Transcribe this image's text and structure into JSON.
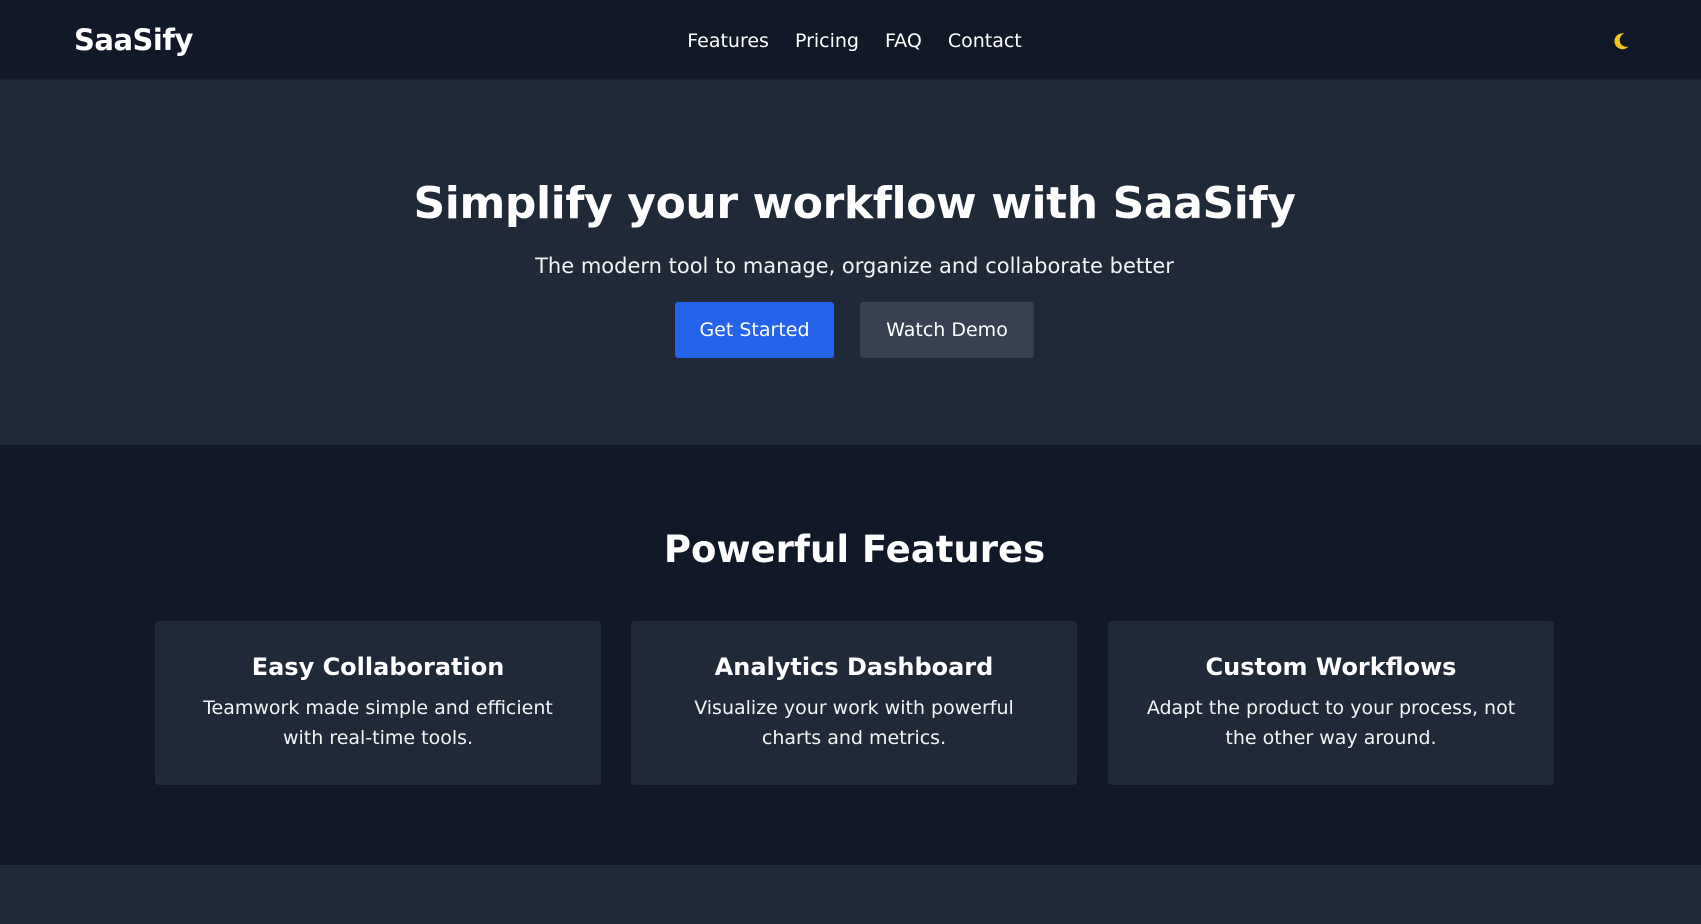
{
  "nav": {
    "logo": "SaaSify",
    "links": [
      "Features",
      "Pricing",
      "FAQ",
      "Contact"
    ],
    "theme_icon": "moon-icon"
  },
  "hero": {
    "title": "Simplify your workflow with SaaSify",
    "subtitle": "The modern tool to manage, organize and collaborate better",
    "primary_button": "Get Started",
    "secondary_button": "Watch Demo"
  },
  "features": {
    "title": "Powerful Features",
    "cards": [
      {
        "title": "Easy Collaboration",
        "description": "Teamwork made simple and efficient with real-time tools."
      },
      {
        "title": "Analytics Dashboard",
        "description": "Visualize your work with powerful charts and metrics."
      },
      {
        "title": "Custom Workflows",
        "description": "Adapt the product to your process, not the other way around."
      }
    ]
  },
  "colors": {
    "background": "#111827",
    "surface": "#1f2937",
    "primary": "#2563eb",
    "secondary": "#374151",
    "moon": "#f5c518"
  }
}
